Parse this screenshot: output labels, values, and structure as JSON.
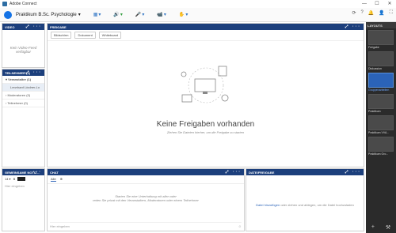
{
  "window": {
    "title": "Adobe Connect",
    "controls": [
      "—",
      "☐",
      "✕"
    ]
  },
  "topbar": {
    "room": "Praktikum B.Sc. Psychologie",
    "right_icons": [
      "sync-icon",
      "help-icon",
      "bell-icon",
      "user-icon",
      "fullscreen-icon"
    ]
  },
  "video": {
    "title": "VIDEO",
    "empty": "Kein Video-Feed verfügbar"
  },
  "attendees": {
    "title": "TEILNEHMER (1)",
    "host_group": "Veranstalter (1)",
    "host_name": "Leonhard Lindner-Lo",
    "presenters": "Moderatoren (0)",
    "participants": "Teilnehmer (0)"
  },
  "share": {
    "title": "FREIGABE",
    "tools": [
      "Bildschirm",
      "Dokument",
      "Whiteboard"
    ],
    "empty_title": "Keine Freigaben vorhanden",
    "empty_sub": "Ziehen Sie Dateien hierher, um die Freigabe zu starten"
  },
  "notes": {
    "title": "GEMEINSAME NOTIZ...",
    "placeholder": "Hier eingeben"
  },
  "chat": {
    "title": "CHAT",
    "tab": "Alle",
    "empty_1": "Starten Sie eine Unterhaltung mit allen oder",
    "empty_2": "reden Sie privat mit den Veranstaltern, Moderatoren oder einem Teilnehmer",
    "placeholder": "Hier eingeben"
  },
  "files": {
    "title": "DATEIFREIGABE",
    "link": "Datei hinzufügen",
    "text": "oder ziehen und ablegen, um die Datei hochzuladen"
  },
  "layouts": {
    "title": "LAYOUTS",
    "items": [
      "Freigabe",
      "Diskussion",
      "Gruppenarbeiten",
      "Praktikum",
      "Praktikum VVA...",
      "Praktikum Gro..."
    ]
  },
  "colors": {
    "pod_header": "#1c3f7c",
    "accent": "#2b63b8"
  }
}
